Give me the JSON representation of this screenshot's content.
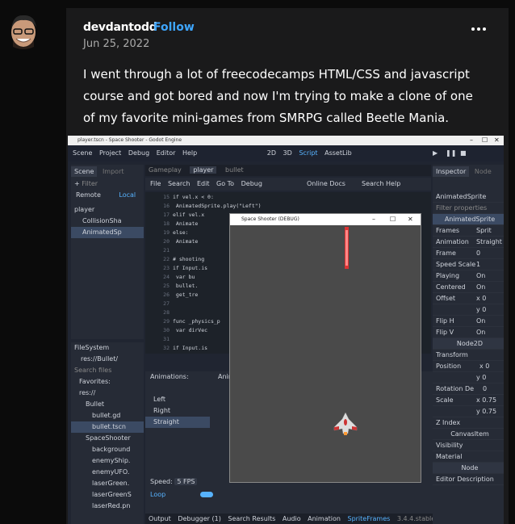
{
  "post": {
    "username": "devdantodd",
    "follow_label": "Follow",
    "date": "Jun 25, 2022",
    "body": "I went through a lot of freecodecamps HTML/CSS and javascript course and got bored and now I'm trying to make a clone of one of my favorite mini-games from SMRPG called Beetle Mania."
  },
  "editor": {
    "window_title": "player.tscn - Space Shooter - Godot Engine",
    "menu": [
      "Scene",
      "Project",
      "Debug",
      "Editor",
      "Help"
    ],
    "modes": [
      "2D",
      "3D",
      "Script",
      "AssetLib"
    ],
    "scene_tabs": [
      "Scene",
      "Import"
    ],
    "filter_placeholder": "Filter",
    "remote_label": "Remote",
    "local_label": "Local",
    "tree": [
      "player",
      "CollisionSha",
      "AnimatedSp"
    ],
    "file_tabs": [
      "Gameplay",
      "player",
      "bullet"
    ],
    "script_menu": [
      "File",
      "Search",
      "Edit",
      "Go To",
      "Debug"
    ],
    "online_docs": "Online Docs",
    "search_help": "Search Help",
    "code_lines": [
      {
        "n": "15",
        "t": "if vel.x < 0:"
      },
      {
        "n": "16",
        "t": "    AnimatedSprite.play(\"Left\")"
      },
      {
        "n": "17",
        "t": "elif vel.x"
      },
      {
        "n": "18",
        "t": "    Animate"
      },
      {
        "n": "19",
        "t": "else:"
      },
      {
        "n": "20",
        "t": "    Animate"
      },
      {
        "n": "21",
        "t": ""
      },
      {
        "n": "22",
        "t": "# shooting"
      },
      {
        "n": "23",
        "t": "if Input.is"
      },
      {
        "n": "24",
        "t": "    var bu"
      },
      {
        "n": "25",
        "t": "    bullet."
      },
      {
        "n": "26",
        "t": "    get_tre"
      },
      {
        "n": "27",
        "t": ""
      },
      {
        "n": "28",
        "t": ""
      },
      {
        "n": "29",
        "t": "func _physics_p"
      },
      {
        "n": "30",
        "t": "    var dirVec"
      },
      {
        "n": "31",
        "t": ""
      },
      {
        "n": "32",
        "t": "if Input.is"
      }
    ],
    "filesystem_label": "FileSystem",
    "fs_path": "res://Bullet/",
    "fs_search_placeholder": "Search files",
    "fs_items": [
      "Favorites:",
      "res://",
      "Bullet",
      "bullet.gd",
      "bullet.tscn",
      "SpaceShooter",
      "background",
      "enemyShip.",
      "enemyUFO.",
      "laserGreen.",
      "laserGreenS",
      "laserRed.pn"
    ],
    "animations_label": "Animations:",
    "anim_label_short": "Anim",
    "anim_list": [
      "Left",
      "Right",
      "Straight"
    ],
    "speed_label": "Speed:",
    "speed_value": "5 FPS",
    "loop_label": "Loop",
    "bottom_tabs": [
      "Output",
      "Debugger (1)",
      "Search Results",
      "Audio",
      "Animation",
      "SpriteFrames"
    ],
    "version": "3.4.4.stable",
    "debug_window_title": "Space Shooter (DEBUG)",
    "inspector_tabs": [
      "Inspector",
      "Node"
    ],
    "filter_properties": "Filter properties",
    "inspector_node": "AnimatedSprite",
    "inspector_class": "AnimatedSprite",
    "props": [
      {
        "k": "Frames",
        "v": "Sprit"
      },
      {
        "k": "Animation",
        "v": "Straight"
      },
      {
        "k": "Frame",
        "v": "0"
      },
      {
        "k": "Speed Scale",
        "v": "1"
      },
      {
        "k": "Playing",
        "v": "On"
      },
      {
        "k": "Centered",
        "v": "On"
      },
      {
        "k": "Offset",
        "v": "x 0"
      },
      {
        "k": "",
        "v": "y 0"
      },
      {
        "k": "Flip H",
        "v": "On"
      },
      {
        "k": "Flip V",
        "v": "On"
      }
    ],
    "node2d": "Node2D",
    "transform": "Transform",
    "position_label": "Position",
    "pos_x": "x 0",
    "pos_y": "y 0",
    "rotation_label": "Rotation De",
    "rotation_value": "0",
    "scale_label": "Scale",
    "scale_x": "x 0.75",
    "scale_y": "y 0.75",
    "sections": [
      "Z Index",
      "CanvasItem",
      "Visibility",
      "Material"
    ],
    "node_label": "Node",
    "editor_description": "Editor Description"
  }
}
